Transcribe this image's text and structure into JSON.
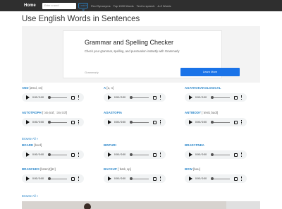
{
  "nav": {
    "brand": "Home",
    "search_placeholder": "Enter a word",
    "search_button": "Look it up",
    "links": [
      "Find Synonyms",
      "Top 1000 Words",
      "Text to speech",
      "A-Z Words"
    ]
  },
  "page_title": "Use English Words in Sentences",
  "ad": {
    "title": "Grammar and Spelling Checker",
    "desc": "Check your grammar, spelling, and punctuation instantly with Grammarly",
    "brand": "Grammarly",
    "button": "Learn More"
  },
  "player_time": "0:00 / 0:00",
  "words": [
    {
      "word": "AND",
      "phon": "[ænd, ən]"
    },
    {
      "word": "A",
      "phon": "[ɑ, ə]"
    },
    {
      "word": "AGATHOKAKOLOGICAL",
      "phon": ""
    },
    {
      "word": "AUTOTROPH",
      "phon": "[ˈɔtəˌtrɑf, ˈɔtəˌtrɔf]"
    },
    {
      "word": "AGASTOPIA",
      "phon": ""
    },
    {
      "word": "ANTIBODY",
      "phon": "[ˈæntɪˌbɑdi]"
    },
    {
      "word": "BOARD",
      "phon": "[bɔrd]"
    },
    {
      "word": "BINTURI",
      "phon": ""
    },
    {
      "word": "BRADYPNEA",
      "phon": ""
    },
    {
      "word": "BRANCHES",
      "phon": "[bræn(t)ʃɪz]"
    },
    {
      "word": "BACKUP",
      "phon": "[ˈbækˌəp]"
    },
    {
      "word": "BOW",
      "phon": "[bɑʊ]"
    }
  ],
  "browse": [
    "Browse All »",
    "Browse All »"
  ]
}
